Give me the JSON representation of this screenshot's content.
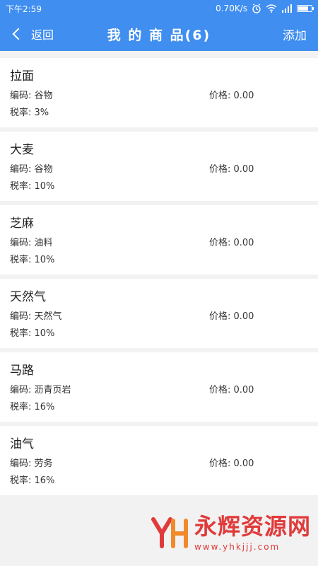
{
  "status_bar": {
    "time": "下午2:59",
    "network_speed": "0.70K/s",
    "icons": [
      "alarm-icon",
      "wifi-icon",
      "signal-icon",
      "battery-icon"
    ],
    "battery_level": 0.78
  },
  "nav": {
    "back_label": "返回",
    "title": "我 的 商 品(6)",
    "add_label": "添加"
  },
  "products": [
    {
      "name": "拉面",
      "code_label": "编码: 谷物",
      "price_label": "价格: 0.00",
      "tax_label": "税率: 3%"
    },
    {
      "name": "大麦",
      "code_label": "编码: 谷物",
      "price_label": "价格: 0.00",
      "tax_label": "税率: 10%"
    },
    {
      "name": "芝麻",
      "code_label": "编码: 油料",
      "price_label": "价格: 0.00",
      "tax_label": "税率: 10%"
    },
    {
      "name": "天然气",
      "code_label": "编码: 天然气",
      "price_label": "价格: 0.00",
      "tax_label": "税率: 10%"
    },
    {
      "name": "马路",
      "code_label": "编码: 沥青页岩",
      "price_label": "价格: 0.00",
      "tax_label": "税率: 16%"
    },
    {
      "name": "油气",
      "code_label": "编码: 劳务",
      "price_label": "价格: 0.00",
      "tax_label": "税率: 16%"
    }
  ],
  "watermark": {
    "logo_text": "YH",
    "title": "永辉资源网",
    "url": "www.yhkjjj.com"
  },
  "colors": {
    "brand_blue": "#3f8ef0",
    "watermark_red": "#e03a3a"
  }
}
